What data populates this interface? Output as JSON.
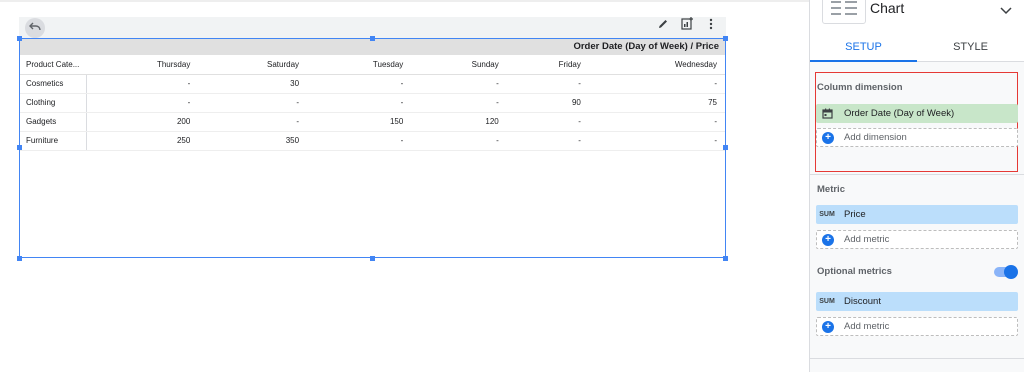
{
  "chart_table": {
    "header_title": "Order Date (Day of Week) / Price",
    "row_header": "Product Cate...",
    "columns": [
      "Thursday",
      "Saturday",
      "Tuesday",
      "Sunday",
      "Friday",
      "Wednesday"
    ],
    "rows": [
      {
        "label": "Cosmetics",
        "values": [
          "-",
          "30",
          "-",
          "-",
          "-",
          "-"
        ]
      },
      {
        "label": "Clothing",
        "values": [
          "-",
          "-",
          "-",
          "-",
          "90",
          "75"
        ]
      },
      {
        "label": "Gadgets",
        "values": [
          "200",
          "-",
          "150",
          "120",
          "-",
          "-"
        ]
      },
      {
        "label": "Furniture",
        "values": [
          "250",
          "350",
          "-",
          "-",
          "-",
          "-"
        ]
      }
    ]
  },
  "panel": {
    "chart_label": "Chart",
    "tabs": {
      "setup": "SETUP",
      "style": "STYLE"
    },
    "column_dimension": {
      "title": "Column dimension",
      "selected": "Order Date (Day of Week)",
      "add_label": "Add dimension"
    },
    "metric": {
      "title": "Metric",
      "agg": "SUM",
      "selected": "Price",
      "add_label": "Add metric"
    },
    "optional_metrics": {
      "title": "Optional metrics",
      "enabled": true,
      "agg": "SUM",
      "selected": "Discount",
      "add_label": "Add metric"
    }
  },
  "icons": {
    "undo": "undo-icon",
    "edit": "pencil-icon",
    "explore": "chart-add-icon",
    "more": "more-vert-icon",
    "calendar": "calendar-icon",
    "chevron": "chevron-down-icon"
  },
  "colors": {
    "accent": "#1a73e8",
    "selection": "#4285f4",
    "dimension_chip": "#c8e6c9",
    "metric_chip": "#bbdefb",
    "highlight": "#e53935"
  }
}
